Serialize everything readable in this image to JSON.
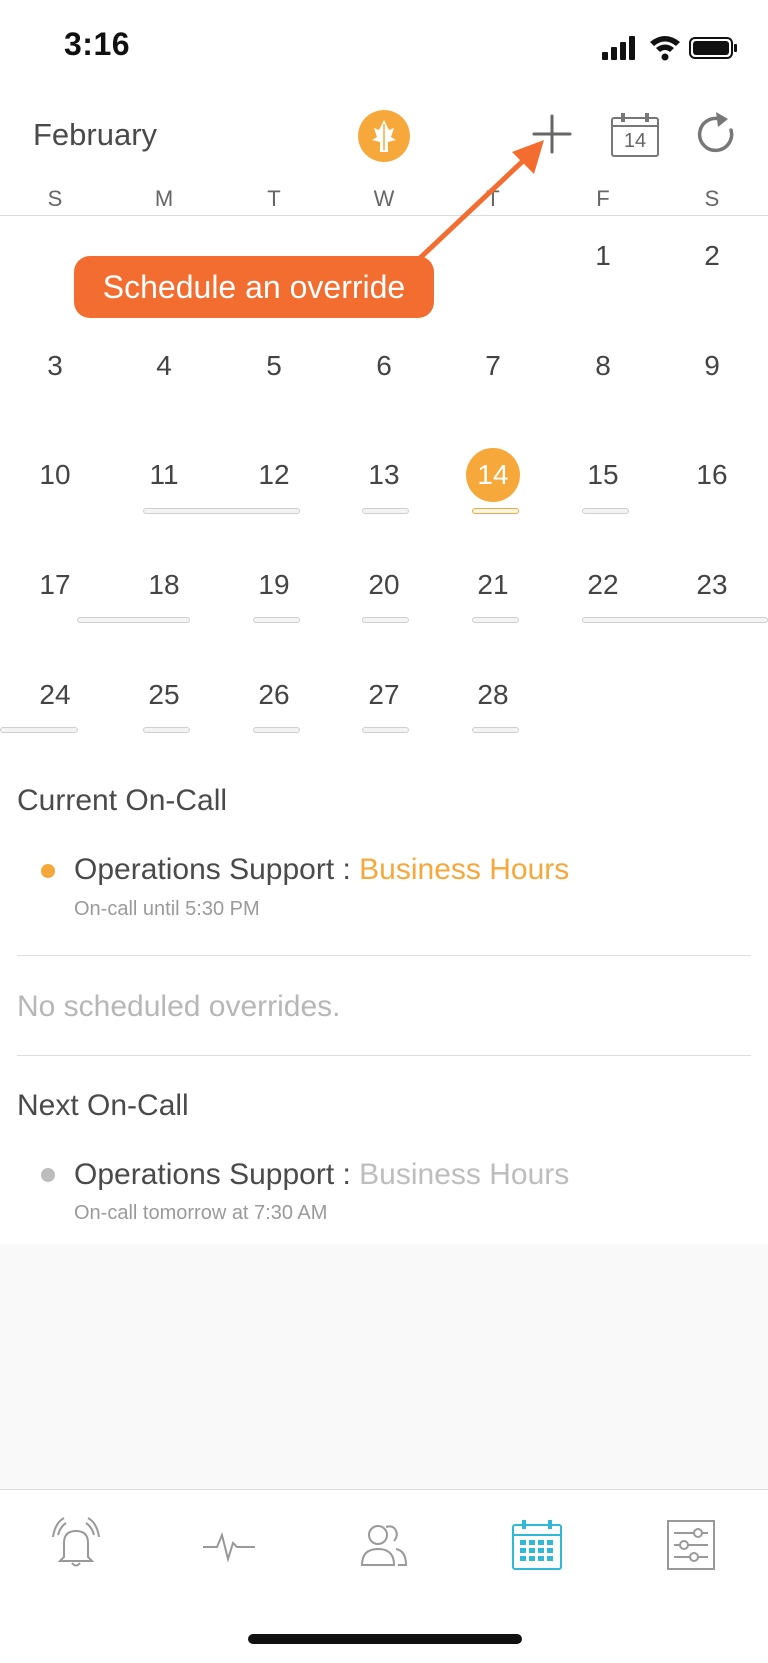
{
  "status_bar": {
    "time": "3:16"
  },
  "header": {
    "month": "February",
    "calendar_icon_day": "14"
  },
  "weekdays": [
    "S",
    "M",
    "T",
    "W",
    "T",
    "F",
    "S"
  ],
  "callout": {
    "text": "Schedule an override"
  },
  "calendar": {
    "today": "14",
    "days": [
      "1",
      "2",
      "3",
      "4",
      "5",
      "6",
      "7",
      "8",
      "9",
      "10",
      "11",
      "12",
      "13",
      "14",
      "15",
      "16",
      "17",
      "18",
      "19",
      "20",
      "21",
      "22",
      "23",
      "24",
      "25",
      "26",
      "27",
      "28"
    ]
  },
  "current_oncall": {
    "title": "Current On-Call",
    "team": "Operations Support : ",
    "schedule": "Business Hours",
    "detail": "On-call until 5:30 PM"
  },
  "overrides": {
    "empty_text": "No scheduled overrides."
  },
  "next_oncall": {
    "title": "Next On-Call",
    "team": "Operations Support : ",
    "schedule": "Business Hours",
    "detail": "On-call tomorrow at 7:30 AM"
  },
  "tabs": [
    {
      "icon": "alerts-bell-icon",
      "active": false
    },
    {
      "icon": "activity-pulse-icon",
      "active": false
    },
    {
      "icon": "people-icon",
      "active": false
    },
    {
      "icon": "calendar-icon",
      "active": true
    },
    {
      "icon": "settings-sliders-icon",
      "active": false
    }
  ],
  "colors": {
    "accent": "#f6a83b",
    "callout": "#f26d2f",
    "active_tab": "#2fb8d8",
    "inactive": "#9a9a9a"
  }
}
